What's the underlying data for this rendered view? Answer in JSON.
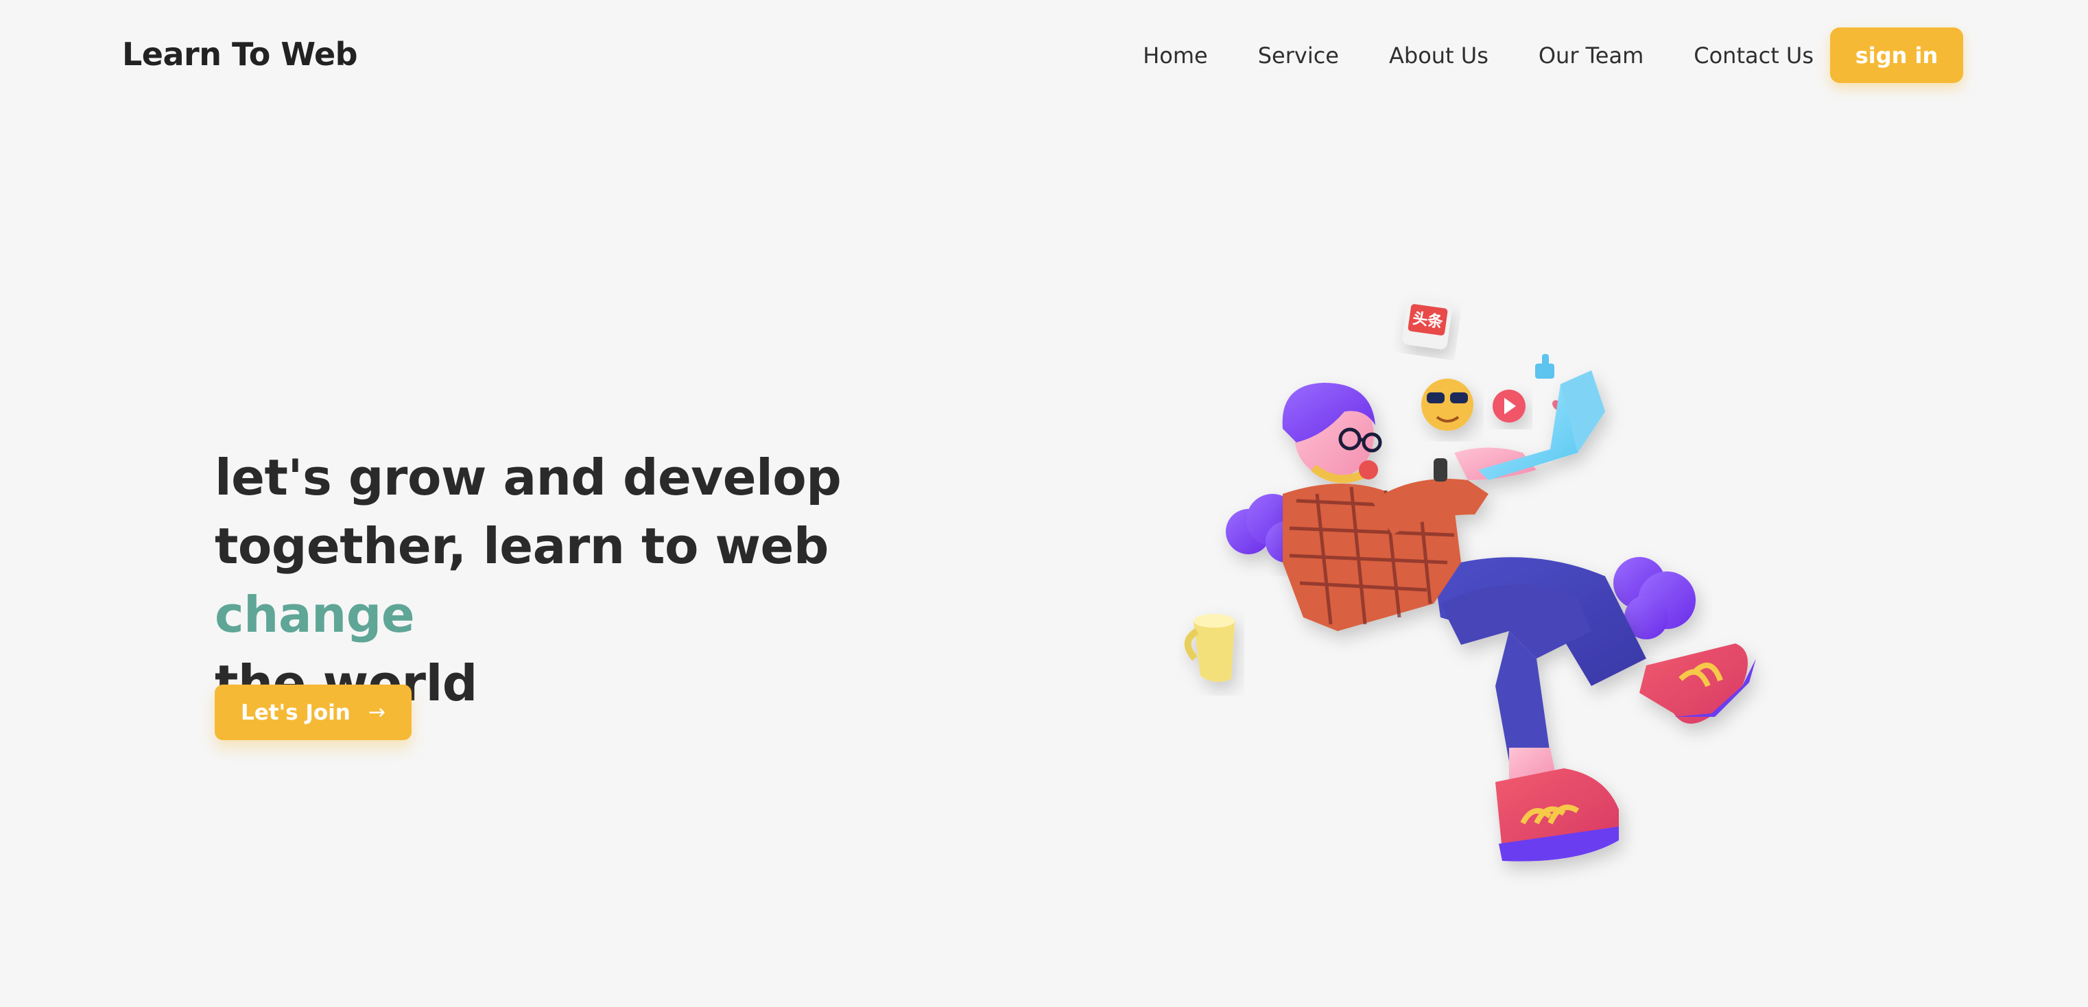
{
  "header": {
    "logo": "Learn To Web",
    "nav": [
      "Home",
      "Service",
      "About Us",
      "Our Team",
      "Contact Us"
    ],
    "sign_in_label": "sign in"
  },
  "hero": {
    "heading_line1": "let's grow and develop",
    "heading_line2_pre": "together, learn to web ",
    "heading_highlight": "change",
    "heading_line3": "the world",
    "join_label": "Let's Join",
    "join_icon": "arrow-right-icon"
  },
  "illustration": {
    "subject": "3d-character-with-laptop",
    "sticker_text": "头条"
  },
  "colors": {
    "background": "#f6f6f6",
    "accent": "#f6b935",
    "highlight": "#5fa697",
    "text": "#2a2a2a"
  }
}
